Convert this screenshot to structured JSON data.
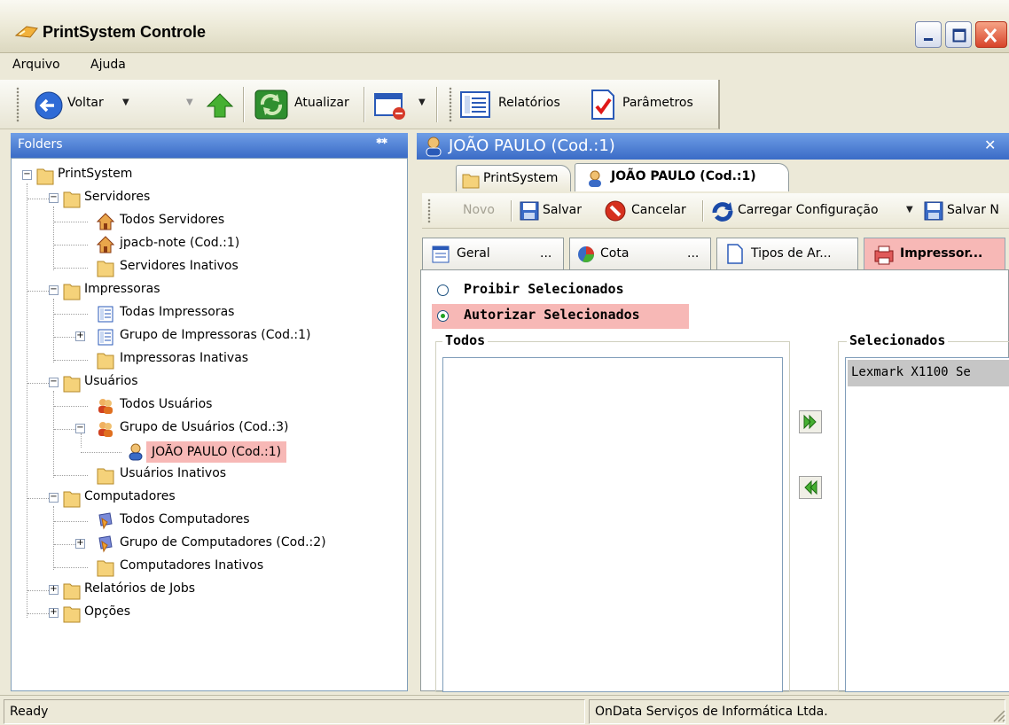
{
  "window": {
    "title": "PrintSystem Controle"
  },
  "menu": {
    "items": [
      "Arquivo",
      "Ajuda"
    ]
  },
  "toolbar": {
    "back_label": "Voltar",
    "refresh_label": "Atualizar",
    "reports_label": "Relatórios",
    "params_label": "Parâmetros"
  },
  "left_panel": {
    "title": "Folders",
    "tree": [
      "PrintSystem",
      "Servidores",
      "Todos Servidores",
      "jpacb-note (Cod.:1)",
      "Servidores Inativos",
      "Impressoras",
      "Todas Impressoras",
      "Grupo de Impressoras (Cod.:1)",
      "Impressoras Inativas",
      "Usuários",
      "Todos Usuários",
      "Grupo de Usuários (Cod.:3)",
      "JOÃO PAULO (Cod.:1)",
      "Usuários Inativos",
      "Computadores",
      "Todos Computadores",
      "Grupo de Computadores (Cod.:2)",
      "Computadores Inativos",
      "Relatórios de Jobs",
      "Opções"
    ]
  },
  "right_panel": {
    "title": "JOÃO PAULO (Cod.:1)",
    "doc_tabs": [
      "PrintSystem",
      "JOÃO PAULO (Cod.:1)"
    ],
    "doc_toolbar": {
      "new_label": "Novo",
      "save_label": "Salvar",
      "cancel_label": "Cancelar",
      "load_config_label": "Carregar Configuração",
      "save_n_label": "Salvar N"
    },
    "inner_tabs": [
      "Geral",
      "...",
      "Cota",
      "...",
      "Tipos de Ar...",
      "Impressor..."
    ],
    "radio_options": [
      "Proibir Selecionados",
      "Autorizar Selecionados"
    ],
    "selected_radio": "Autorizar Selecionados",
    "groups": {
      "all_label": "Todos",
      "selected_label": "Selecionados"
    },
    "selected_items": [
      "Lexmark X1100 Se"
    ]
  },
  "status": {
    "left": "Ready",
    "right": "OnData Serviços de Informática Ltda."
  },
  "colors": {
    "header_blue": "#3a6bc6",
    "highlight_pink": "#f7b8b6",
    "window_face": "#ece9d8"
  },
  "icons": [
    "app-icon",
    "minimize-icon",
    "maximize-icon",
    "close-icon",
    "back-arrow-icon",
    "up-arrow-icon",
    "refresh-icon",
    "window-icon",
    "report-icon",
    "parameters-icon",
    "folder-icon",
    "house-icon",
    "printer-list-icon",
    "users-icon",
    "user-icon",
    "computer-icon",
    "save-icon",
    "cancel-icon",
    "load-config-icon",
    "pin-icon",
    "move-right-icon",
    "move-left-icon"
  ]
}
